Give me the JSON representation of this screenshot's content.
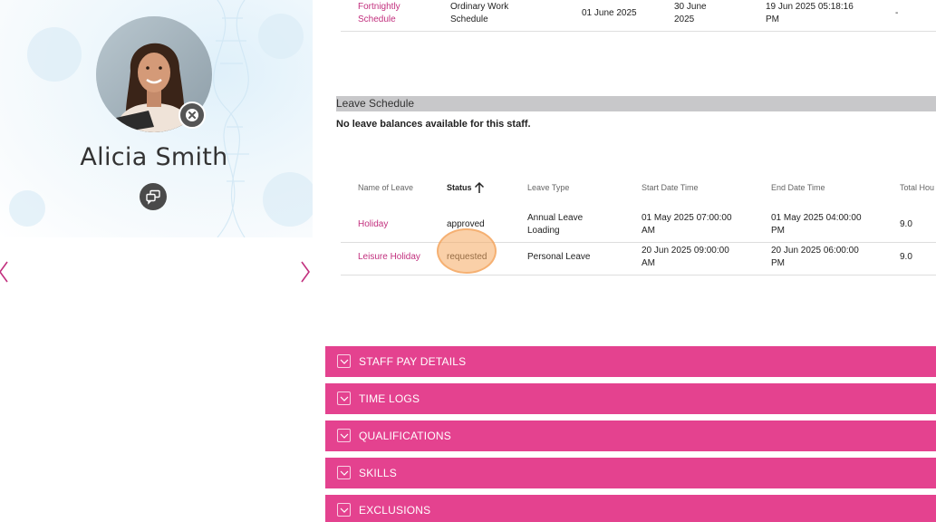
{
  "profile": {
    "name": "Alicia Smith"
  },
  "work_schedule_row": {
    "name": "Fortnightly Schedule",
    "type": "Ordinary Work Schedule",
    "start_date": "01 June 2025",
    "end_date": "30 June 2025",
    "modified": "19 Jun 2025 05:18:16 PM",
    "extra": "-"
  },
  "leave_schedule": {
    "title": "Leave Schedule",
    "no_balance_message": "No leave balances available for this staff.",
    "columns": [
      "Name of Leave",
      "Status",
      "Leave Type",
      "Start Date Time",
      "End Date Time",
      "Total Hou"
    ],
    "rows": [
      {
        "name": "Holiday",
        "status": "approved",
        "leave_type": "Annual Leave Loading",
        "start": "01 May 2025 07:00:00 AM",
        "end": "01 May 2025 04:00:00 PM",
        "total": "9.0"
      },
      {
        "name": "Leisure Holiday",
        "status": "requested",
        "leave_type": "Personal Leave",
        "start": "20 Jun 2025 09:00:00 AM",
        "end": "20 Jun 2025 06:00:00 PM",
        "total": "9.0"
      }
    ]
  },
  "accordions": [
    {
      "label": "STAFF PAY DETAILS"
    },
    {
      "label": "TIME LOGS"
    },
    {
      "label": "QUALIFICATIONS"
    },
    {
      "label": "SKILLS"
    },
    {
      "label": "EXCLUSIONS"
    }
  ],
  "colors": {
    "accent": "#e4428f",
    "link": "#c2307e",
    "section_header": "#c8c8ca"
  },
  "icons": {
    "remove": "close-circle-icon",
    "chat": "chat-bubbles-icon",
    "prev": "chevron-left-icon",
    "next": "chevron-right-icon",
    "sort": "arrow-up-icon",
    "accordion": "chevron-down-icon"
  }
}
